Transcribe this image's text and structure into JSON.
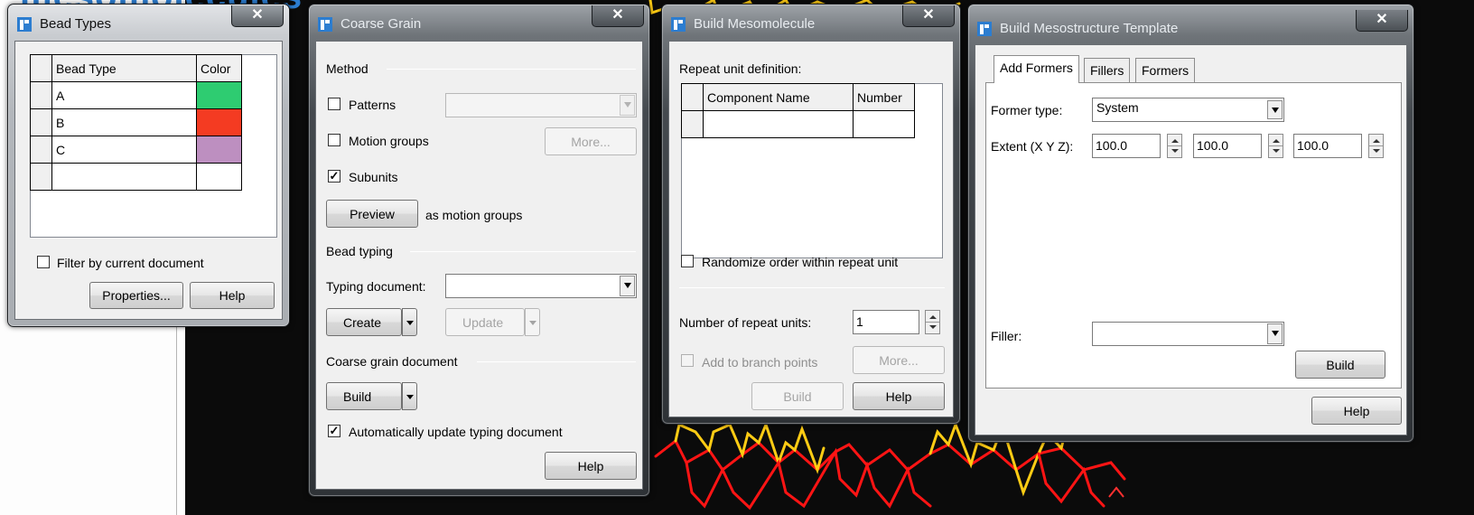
{
  "background": {
    "heading": "mesomolecules"
  },
  "bead_types": {
    "title": "Bead Types",
    "columns": {
      "bead_type": "Bead Type",
      "color": "Color"
    },
    "rows": [
      {
        "bead_type": "A",
        "color": "#2ecc71"
      },
      {
        "bead_type": "B",
        "color": "#f43b22"
      },
      {
        "bead_type": "C",
        "color": "#bd8fc0"
      }
    ],
    "filter_label": "Filter by current document",
    "properties_button": "Properties...",
    "help_button": "Help"
  },
  "coarse_grain": {
    "title": "Coarse Grain",
    "method_heading": "Method",
    "patterns_label": "Patterns",
    "motion_groups_label": "Motion groups",
    "more_button": "More...",
    "subunits_label": "Subunits",
    "subunits_checked": true,
    "preview_button": "Preview",
    "as_motion_groups": "as motion groups",
    "bead_typing_heading": "Bead typing",
    "typing_document_label": "Typing document:",
    "create_button": "Create",
    "update_button": "Update",
    "cg_document_heading": "Coarse grain document",
    "build_button": "Build",
    "auto_update_label": "Automatically update typing document",
    "auto_update_checked": true,
    "help_button": "Help"
  },
  "build_mesomolecule": {
    "title": "Build Mesomolecule",
    "repeat_unit_label": "Repeat unit definition:",
    "columns": {
      "component_name": "Component Name",
      "number": "Number"
    },
    "randomize_label": "Randomize order within repeat unit",
    "repeat_units_label": "Number of repeat units:",
    "repeat_units_value": "1",
    "branch_points_label": "Add to branch points",
    "more_button": "More...",
    "build_button": "Build",
    "help_button": "Help"
  },
  "build_template": {
    "title": "Build Mesostructure Template",
    "tabs": [
      "Add Formers",
      "Fillers",
      "Formers"
    ],
    "former_type_label": "Former type:",
    "former_type_value": "System",
    "extent_label": "Extent (X Y Z):",
    "extent_x": "100.0",
    "extent_y": "100.0",
    "extent_z": "100.0",
    "filler_label": "Filler:",
    "build_button": "Build",
    "help_button": "Help"
  },
  "colors": {
    "molecule_bond": "#ff1414",
    "molecule_atom": "#ffcc14",
    "accent_blue": "#2c7dd0"
  }
}
